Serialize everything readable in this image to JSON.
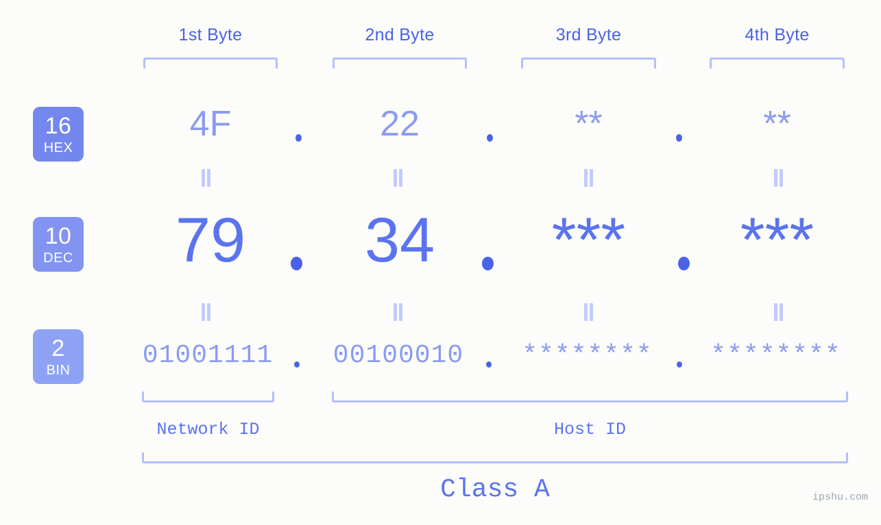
{
  "background_color": "#fcfdfa",
  "accent_color": "#5b73ee",
  "accent_light_color": "#8b9bf0",
  "bracket_color": "#b5bffa",
  "badge_color": "#7487ee",
  "badge_color_light": "#8ea2f5",
  "byte_headers": [
    {
      "label": "1st Byte"
    },
    {
      "label": "2nd Byte"
    },
    {
      "label": "3rd Byte"
    },
    {
      "label": "4th Byte"
    }
  ],
  "rows": {
    "hex": {
      "badge_number": "16",
      "badge_system": "HEX",
      "octets": [
        "4F",
        "22",
        "**",
        "**"
      ],
      "separator": "."
    },
    "dec": {
      "badge_number": "10",
      "badge_system": "DEC",
      "octets": [
        "79",
        "34",
        "***",
        "***"
      ],
      "separator": "."
    },
    "bin": {
      "badge_number": "2",
      "badge_system": "BIN",
      "octets": [
        "01001111",
        "00100010",
        "********",
        "********"
      ],
      "separator": "."
    }
  },
  "equals_marker": "=",
  "footer": {
    "network_id_label": "Network ID",
    "host_id_label": "Host ID",
    "class_label": "Class A",
    "watermark": "ipshu.com"
  }
}
